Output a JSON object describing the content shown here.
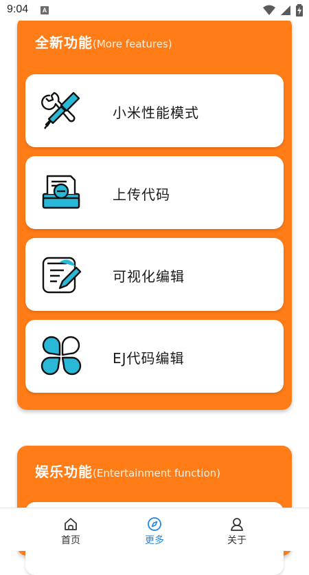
{
  "status_bar": {
    "time": "9:04",
    "notification_letter": "A"
  },
  "sections": [
    {
      "title": "全新功能",
      "subtitle": "(More features)",
      "items": [
        {
          "label": "小米性能模式",
          "icon": "tools-icon"
        },
        {
          "label": "上传代码",
          "icon": "upload-document-icon"
        },
        {
          "label": "可视化编辑",
          "icon": "edit-document-icon"
        },
        {
          "label": "EJ代码编辑",
          "icon": "grid-petals-icon"
        }
      ]
    },
    {
      "title": "娱乐功能",
      "subtitle": "(Entertainment function)",
      "items": []
    }
  ],
  "bottom_nav": [
    {
      "label": "首页",
      "icon": "home-icon",
      "active": false
    },
    {
      "label": "更多",
      "icon": "compass-icon",
      "active": true
    },
    {
      "label": "关于",
      "icon": "user-icon",
      "active": false
    }
  ],
  "colors": {
    "card_orange": "#ff7c17",
    "icon_accent": "#29b8d8",
    "nav_active": "#1e88e5",
    "nav_inactive": "#333333"
  }
}
